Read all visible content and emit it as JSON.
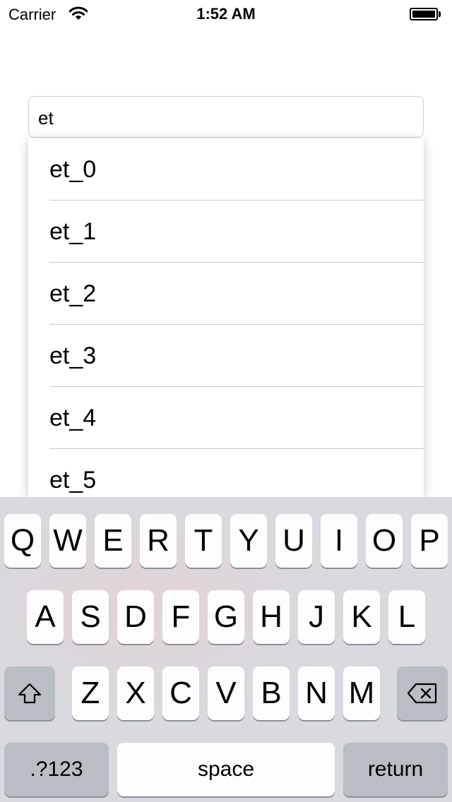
{
  "status_bar": {
    "carrier": "Carrier",
    "time": "1:52 AM",
    "icons": [
      "wifi-icon",
      "battery-icon"
    ]
  },
  "search": {
    "value": "et"
  },
  "suggestions": [
    "et_0",
    "et_1",
    "et_2",
    "et_3",
    "et_4",
    "et_5"
  ],
  "keyboard": {
    "row1": [
      "Q",
      "W",
      "E",
      "R",
      "T",
      "Y",
      "U",
      "I",
      "O",
      "P"
    ],
    "row2": [
      "A",
      "S",
      "D",
      "F",
      "G",
      "H",
      "J",
      "K",
      "L"
    ],
    "row3": [
      "Z",
      "X",
      "C",
      "V",
      "B",
      "N",
      "M"
    ],
    "shift_icon": "shift-icon",
    "delete_icon": "delete-icon",
    "numbers_label": ".?123",
    "space_label": "space",
    "return_label": "return"
  },
  "colors": {
    "keyboard_background": "#d8dadf",
    "key_background": "#fdfdfd",
    "special_key_background": "#b9bdc4",
    "divider": "#c8c7cc"
  }
}
